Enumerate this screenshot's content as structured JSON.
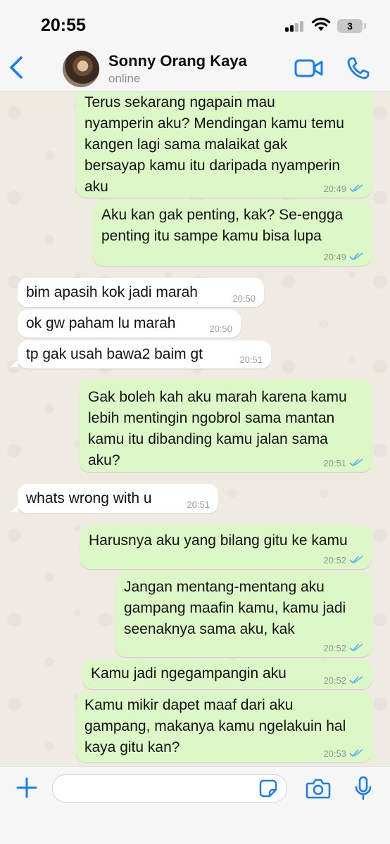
{
  "status_bar": {
    "time": "20:55",
    "battery": "3"
  },
  "header": {
    "contact_name": "Sonny Orang Kaya",
    "status": "online"
  },
  "colors": {
    "accent": "#1a7ef0",
    "outgoing_bubble": "#dcf8c6",
    "incoming_bubble": "#ffffff",
    "read_ticks": "#4fb6ec"
  },
  "messages": [
    {
      "direction": "out",
      "text": "Terus sekarang ngapain mau\nnyamperin aku? Mendingan kamu temu\nkangen lagi sama malaikat gak\nbersayap kamu itu daripada nyamperin\naku",
      "time": "20:49",
      "status": "read"
    },
    {
      "direction": "out",
      "text": "Aku kan gak penting, kak? Se-engga\npenting itu sampe kamu bisa lupa",
      "time": "20:49",
      "status": "read"
    },
    {
      "direction": "in",
      "text": "bim apasih kok jadi marah",
      "time": "20:50"
    },
    {
      "direction": "in",
      "text": "ok gw paham lu marah",
      "time": "20:50"
    },
    {
      "direction": "in",
      "text": "tp gak usah bawa2 baim gt",
      "time": "20:51"
    },
    {
      "direction": "out",
      "text": "Gak boleh kah aku marah karena kamu\nlebih mentingin ngobrol sama mantan\nkamu itu dibanding kamu jalan sama\naku?",
      "time": "20:51",
      "status": "read"
    },
    {
      "direction": "in",
      "text": "whats wrong with u",
      "time": "20:51"
    },
    {
      "direction": "out",
      "text": "Harusnya aku yang bilang gitu ke kamu",
      "time": "20:52",
      "status": "read"
    },
    {
      "direction": "out",
      "text": "Jangan mentang-mentang aku\ngampang maafin kamu, kamu jadi\nseenaknya sama aku, kak",
      "time": "20:52",
      "status": "read"
    },
    {
      "direction": "out",
      "text": "Kamu jadi ngegampangin aku",
      "time": "20:52",
      "status": "read"
    },
    {
      "direction": "out",
      "text": "Kamu mikir dapet maaf dari aku\ngampang, makanya kamu ngelakuin hal\nkaya gitu kan?",
      "time": "20:53",
      "status": "read"
    }
  ],
  "input": {
    "placeholder": ""
  }
}
